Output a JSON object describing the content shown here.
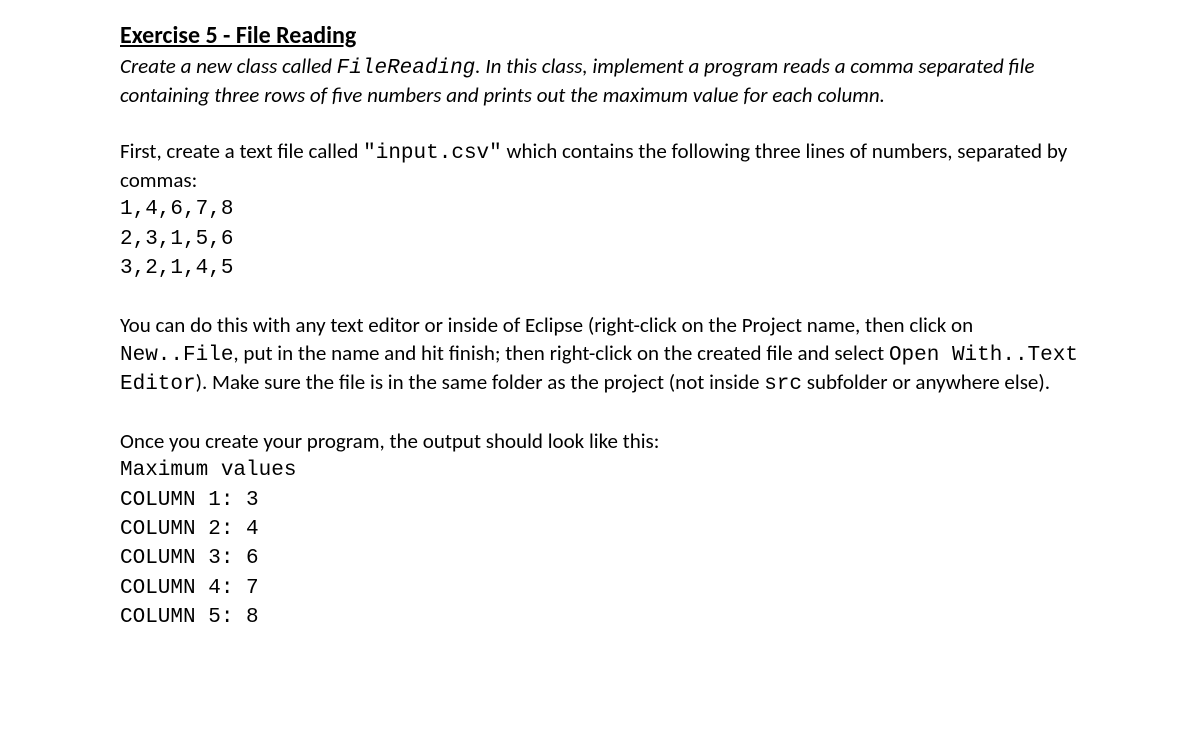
{
  "heading": "Exercise 5 - File Reading",
  "intro_before_mono": "Create a new class called ",
  "intro_mono": "FileReading",
  "intro_after_mono": ". In this class, implement a program reads a comma separated file containing three rows of five numbers and prints out the maximum value for each column.",
  "p2_before_mono": "First, create a text file called ",
  "p2_mono": "\"input.csv\"",
  "p2_after_mono": " which contains the following three lines of numbers, separated by commas:",
  "csv_line1": "1,4,6,7,8",
  "csv_line2": "2,3,1,5,6",
  "csv_line3": "3,2,1,4,5",
  "p3_part1": "You can do this with any text editor or inside of Eclipse (right-click on the Project name, then click on ",
  "p3_mono1": "New..File",
  "p3_part2": ", put in the name and hit finish; then right-click on the created file and select ",
  "p3_mono2": "Open With..Text Editor",
  "p3_part3": "). Make sure the file is in the same folder as the project (not inside ",
  "p3_mono3": "src",
  "p3_part4": " subfolder or anywhere else).",
  "p4": "Once you create your program, the output should look like this:",
  "out_line1": "Maximum values",
  "out_line2": "COLUMN 1: 3",
  "out_line3": "COLUMN 2: 4",
  "out_line4": "COLUMN 3: 6",
  "out_line5": "COLUMN 4: 7",
  "out_line6": "COLUMN 5: 8"
}
